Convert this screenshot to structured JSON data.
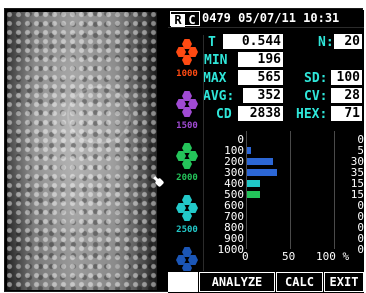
{
  "header": {
    "mode_r": "R",
    "mode_c": "C",
    "datetime": "0479 05/07/11 10:31"
  },
  "stats": {
    "T_label": "T",
    "T_value": "0.544",
    "N_label": "N:",
    "N_value": "20",
    "MIN_label": "MIN",
    "MIN_value": "196",
    "MAX_label": "MAX",
    "MAX_value": "565",
    "SD_label": "SD:",
    "SD_value": "100",
    "AVG_label": "AVG:",
    "AVG_value": "352",
    "CV_label": "CV:",
    "CV_value": "28",
    "CD_label": "CD",
    "CD_value": "2838",
    "HEX_label": "HEX:",
    "HEX_value": "71"
  },
  "legend": {
    "items": [
      {
        "label": "1000",
        "color": "#ff4a12"
      },
      {
        "label": "1500",
        "color": "#a04ad3"
      },
      {
        "label": "2000",
        "color": "#24c45a"
      },
      {
        "label": "2500",
        "color": "#22c9c9"
      },
      {
        "label": "3000",
        "color": "#1b56b7"
      }
    ]
  },
  "histogram": {
    "y_labels": [
      "0",
      "100",
      "200",
      "300",
      "400",
      "500",
      "600",
      "700",
      "800",
      "900",
      "1000"
    ],
    "right_labels": [
      "0",
      "5",
      "30",
      "35",
      "15",
      "15",
      "0",
      "0",
      "0",
      "0",
      "0"
    ],
    "x_labels": [
      "0",
      "50",
      "100 %"
    ],
    "bars": [
      {
        "bin": "100",
        "percent": 5,
        "color": "#2c67d6"
      },
      {
        "bin": "200",
        "percent": 30,
        "color": "#2c67d6"
      },
      {
        "bin": "300",
        "percent": 35,
        "color": "#2c67d6"
      },
      {
        "bin": "400",
        "percent": 15,
        "color": "#20c8c8"
      },
      {
        "bin": "500",
        "percent": 15,
        "color": "#24c45a"
      }
    ]
  },
  "buttons": {
    "blank": "",
    "analyze": "ANALYZE",
    "calc": "CALC",
    "exit": "EXIT"
  },
  "chart_data": {
    "type": "bar",
    "categories": [
      "0",
      "100",
      "200",
      "300",
      "400",
      "500",
      "600",
      "700",
      "800",
      "900",
      "1000"
    ],
    "values": [
      0,
      5,
      30,
      35,
      15,
      15,
      0,
      0,
      0,
      0,
      0
    ],
    "title": "",
    "xlabel": "",
    "ylabel": "",
    "xlim": [
      0,
      100
    ]
  }
}
